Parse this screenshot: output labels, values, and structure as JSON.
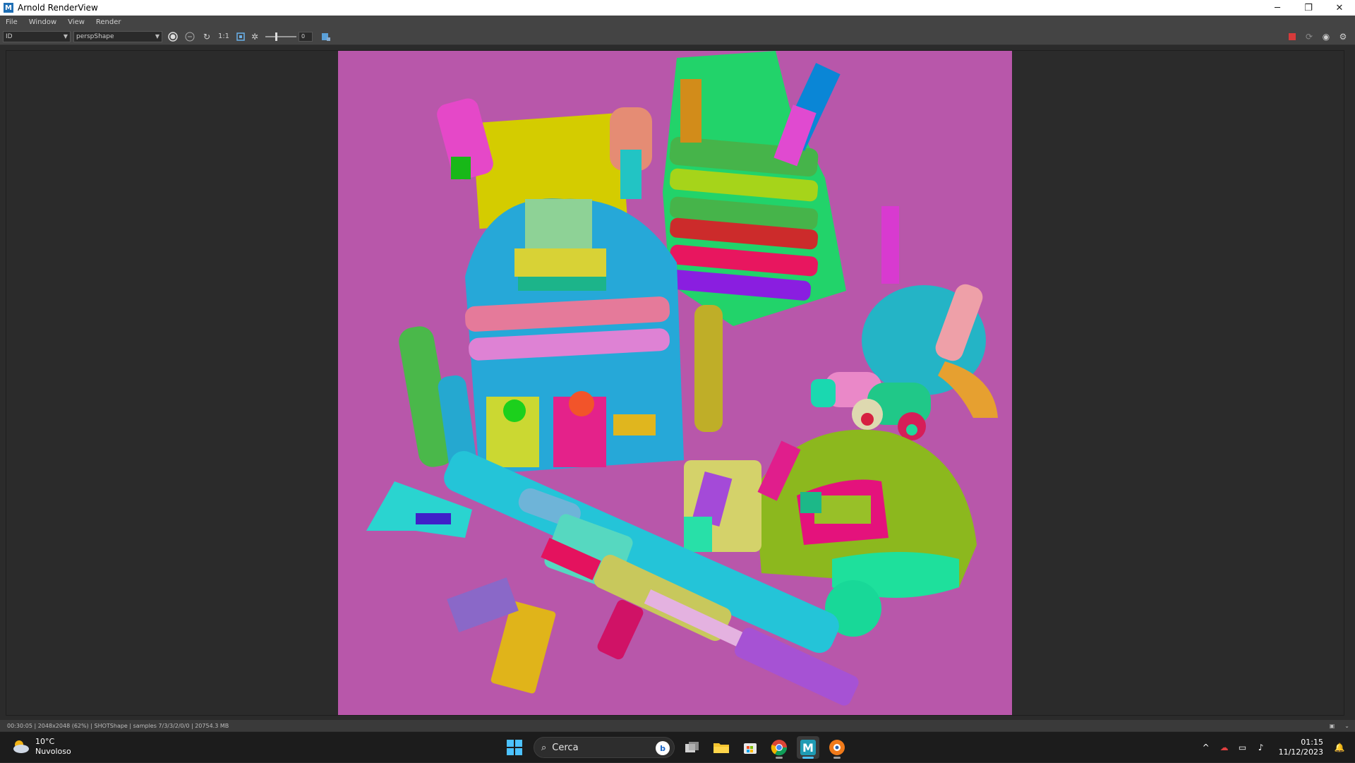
{
  "window": {
    "title": "Arnold RenderView",
    "app_icon": "M",
    "minimize": "─",
    "restore": "❐",
    "close": "✕"
  },
  "menu": {
    "items": [
      "File",
      "Window",
      "View",
      "Render"
    ]
  },
  "toolbar": {
    "aov_select": "ID",
    "camera_select": "perspShape",
    "ratio_label": "1:1",
    "exposure_value": "0"
  },
  "status": {
    "text": "00:30:05 | 2048x2048 (62%) | SHOTShape | samples 7/3/3/2/0/0 | 20754.3 MB"
  },
  "taskbar": {
    "weather_temp": "10°C",
    "weather_desc": "Nuvoloso",
    "search_placeholder": "Cerca",
    "time": "01:15",
    "date": "11/12/2023"
  },
  "colors": {
    "render_background": "#b857aa",
    "accent": "#4cc2ff"
  }
}
